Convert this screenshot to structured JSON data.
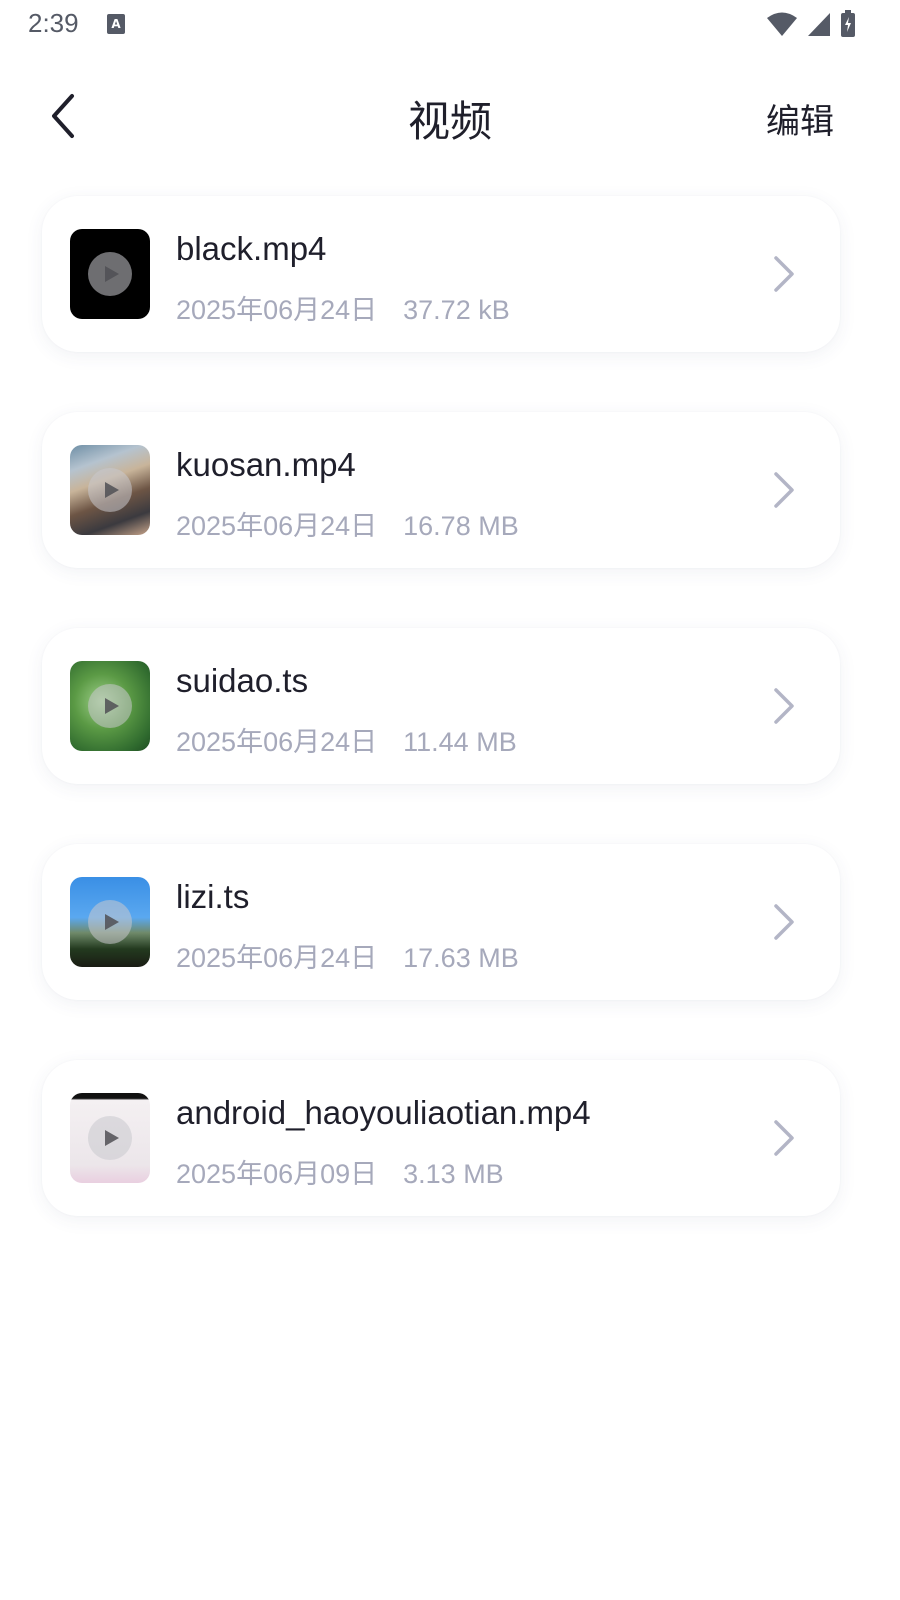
{
  "status_bar": {
    "time": "2:39",
    "icons": [
      "a-notification-icon",
      "wifi-icon",
      "signal-icon",
      "battery-icon"
    ]
  },
  "header": {
    "back_icon": "chevron-left-icon",
    "title": "视频",
    "edit_label": "编辑"
  },
  "videos": [
    {
      "name": "black.mp4",
      "date": "2025年06月24日",
      "size": "37.72 kB",
      "thumb": "black"
    },
    {
      "name": "kuosan.mp4",
      "date": "2025年06月24日",
      "size": "16.78 MB",
      "thumb": "kuosan"
    },
    {
      "name": "suidao.ts",
      "date": "2025年06月24日",
      "size": "11.44 MB",
      "thumb": "suidao"
    },
    {
      "name": "lizi.ts",
      "date": "2025年06月24日",
      "size": "17.63 MB",
      "thumb": "lizi"
    },
    {
      "name": "android_haoyouliaotian.mp4",
      "date": "2025年06月09日",
      "size": "3.13 MB",
      "thumb": "android"
    }
  ],
  "colors": {
    "title": "#1f1f2b",
    "meta": "#a6a9bb",
    "chevron": "#b3b5c6",
    "background": "#ffffff"
  }
}
